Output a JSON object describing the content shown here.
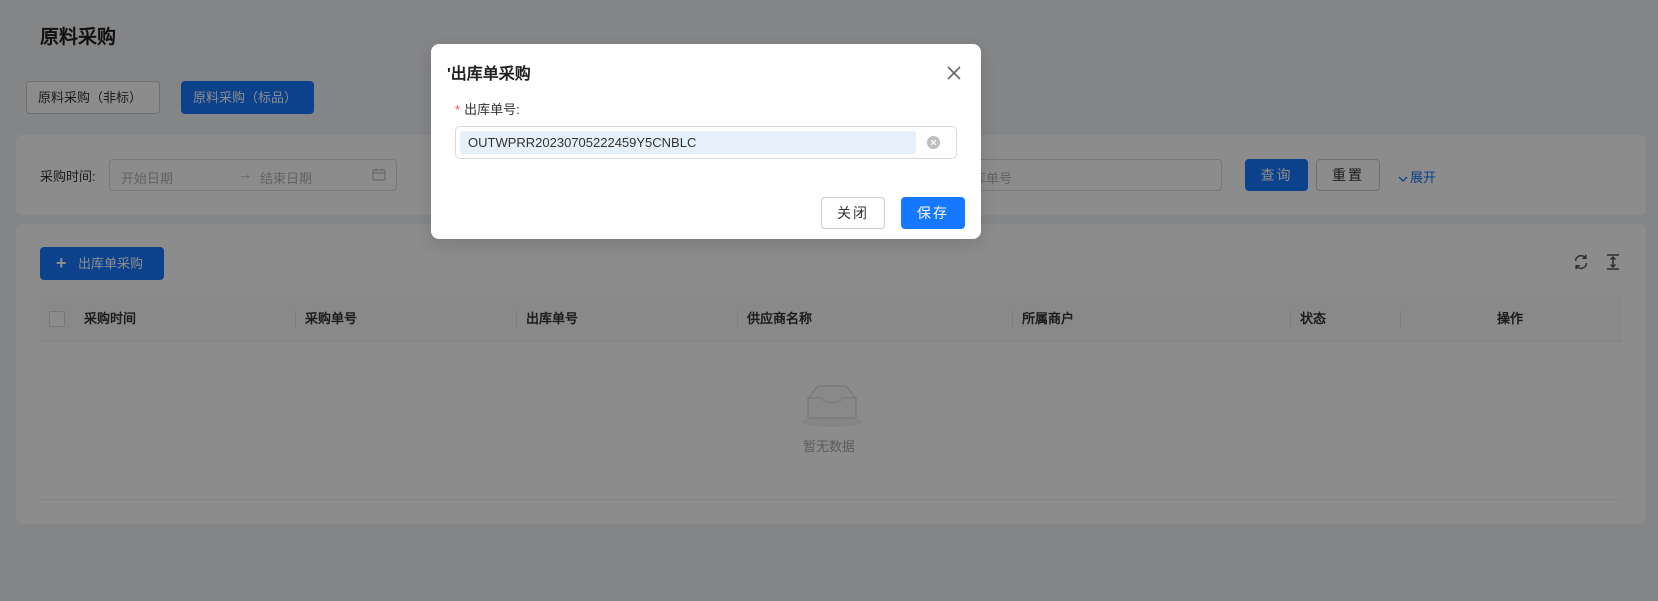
{
  "page": {
    "title": "原料采购"
  },
  "segments": [
    {
      "label": "原料采购（非标）",
      "active": false
    },
    {
      "label": "原料采购（标品）",
      "active": true
    }
  ],
  "filters": {
    "date_label": "采购时间:",
    "start_placeholder": "开始日期",
    "end_placeholder": "结束日期",
    "range_arrow": "→",
    "out_no_placeholder": "库单号",
    "query_label": "查询",
    "reset_label": "重置",
    "expand_label": "展开"
  },
  "table": {
    "add_button_label": "出库单采购",
    "columns": [
      "采购时间",
      "采购单号",
      "出库单号",
      "供应商名称",
      "所属商户",
      "状态",
      "操作"
    ],
    "empty_text": "暂无数据"
  },
  "modal": {
    "title": "'出库单采购",
    "field_label": "出库单号:",
    "required_mark": "*",
    "field_value": "OUTWPRR20230705222459Y5CNBLC",
    "close_label": "关闭",
    "save_label": "保存"
  },
  "colors": {
    "primary": "#1677ff",
    "mask": "rgba(0,0,0,0.45)",
    "required": "#ff4d4f"
  },
  "icons": {
    "close": "close-icon",
    "clear": "clear-icon",
    "calendar": "calendar-icon",
    "refresh": "refresh-icon",
    "column_height": "column-height-icon",
    "empty": "empty-inbox-icon",
    "plus": "plus-icon",
    "expand": "chevron-down-icon"
  }
}
